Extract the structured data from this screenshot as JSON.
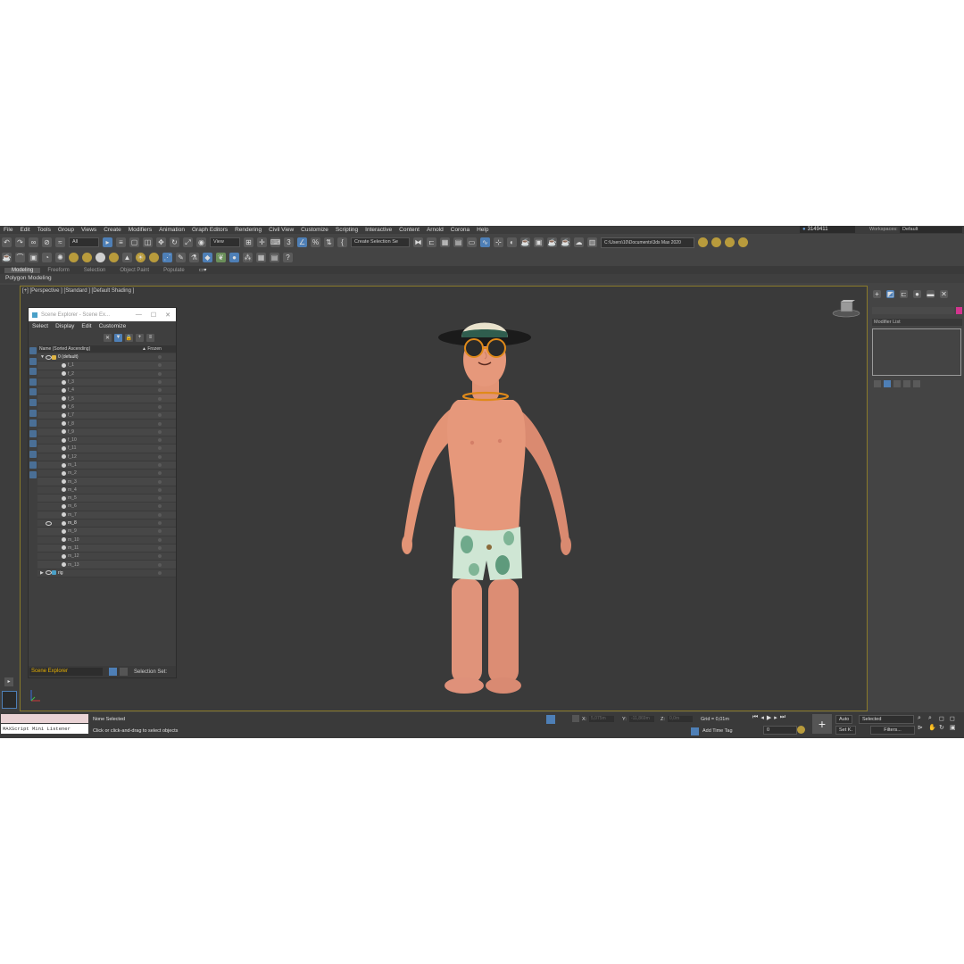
{
  "menu": [
    "File",
    "Edit",
    "Tools",
    "Group",
    "Views",
    "Create",
    "Modifiers",
    "Animation",
    "Graph Editors",
    "Rendering",
    "Civil View",
    "Customize",
    "Scripting",
    "Interactive",
    "Content",
    "Arnold",
    "Corona",
    "Help"
  ],
  "user": "3149411",
  "workspaces_label": "Workspaces:",
  "workspace": "Default",
  "toolbar": {
    "filter_all": "All",
    "view": "View",
    "selection_set": "Create Selection Se",
    "project_path": "C:\\Users\\10\\Documents\\3ds Max 2020"
  },
  "ribbon": {
    "tabs": [
      "Modeling",
      "Freeform",
      "Selection",
      "Object Paint",
      "Populate"
    ],
    "sub": "Polygon Modeling"
  },
  "viewport_label": "[+] [Perspective ] [Standard ] [Default Shading ]",
  "scene_explorer": {
    "title": "Scene Explorer - Scene Ex...",
    "menu": [
      "Select",
      "Display",
      "Edit",
      "Customize"
    ],
    "col_name": "Name (Sorted Ascending)",
    "col_frozen": "▲ Frozen",
    "layer": "0 (default)",
    "objects": [
      "f_1",
      "f_2",
      "f_3",
      "f_4",
      "f_5",
      "f_6",
      "f_7",
      "f_8",
      "f_9",
      "f_10",
      "f_11",
      "f_12",
      "m_1",
      "m_2",
      "m_3",
      "m_4",
      "m_5",
      "m_6",
      "m_7",
      "m_8",
      "m_9",
      "m_10",
      "m_11",
      "m_12",
      "m_13"
    ],
    "highlighted": "m_8",
    "rig": "rig",
    "footer_selector": "Scene Explorer",
    "footer_label": "Selection Set:"
  },
  "command_panel": {
    "modifier_list": "Modifier List",
    "object_color": "#d2358e"
  },
  "status": {
    "maxscript": "MAXScript Mini Listener",
    "selection": "None Selected",
    "prompt": "Click or click-and-drag to select objects",
    "x_label": "X:",
    "x_val": "5,075m",
    "y_label": "Y:",
    "y_val": "-11,869m",
    "z_label": "Z:",
    "z_val": "0,0m",
    "grid": "Grid = 0,01m",
    "add_time_tag": "Add Time Tag",
    "frame": "0",
    "auto": "Auto",
    "set_key": "Set K.",
    "key_filter": "Selected",
    "filters": "Filters..."
  },
  "colors": {
    "viewport_border": "#8a7a2a",
    "accent_blue": "#4e7fb6",
    "skin": "#e39476",
    "shorts": "#cfe6d4",
    "sunglasses_frame": "#e08a1a"
  }
}
